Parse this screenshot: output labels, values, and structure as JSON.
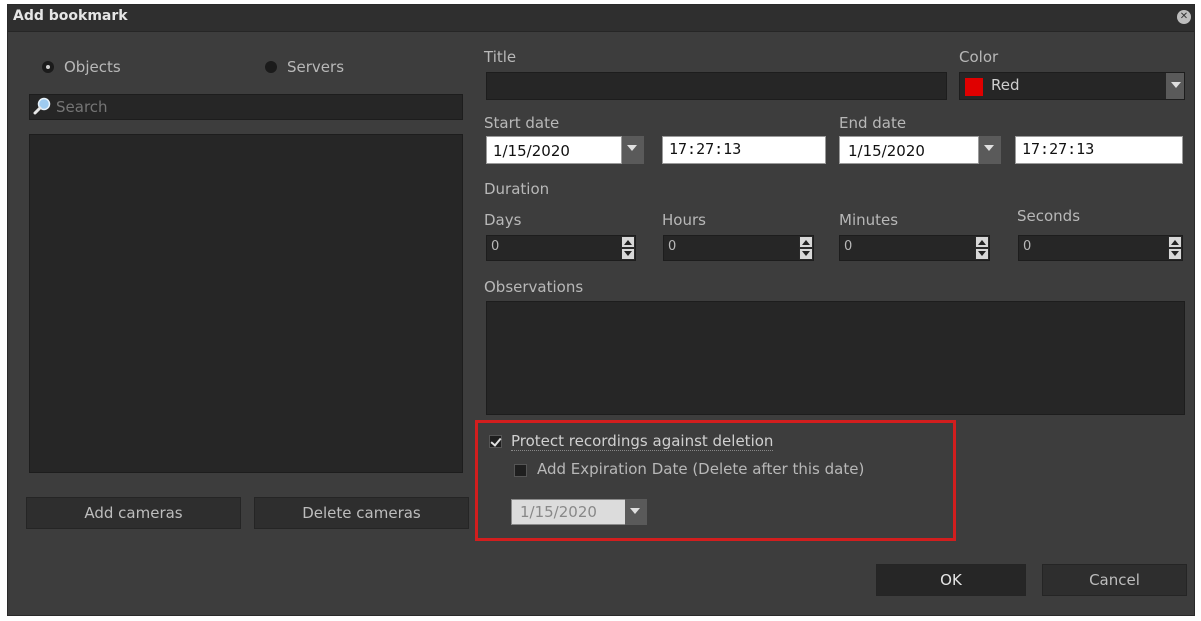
{
  "window": {
    "title": "Add bookmark"
  },
  "left": {
    "radio_objects": "Objects",
    "radio_servers": "Servers",
    "search_placeholder": "Search",
    "add_cameras": "Add cameras",
    "delete_cameras": "Delete cameras"
  },
  "form": {
    "title_label": "Title",
    "title_value": "",
    "color_label": "Color",
    "color_value": "Red",
    "color_swatch": "#e00000",
    "start_label": "Start date",
    "start_date": "1/15/2020",
    "start_time": "17:27:13",
    "end_label": "End date",
    "end_date": "1/15/2020",
    "end_time": "17:27:13",
    "duration_label": "Duration",
    "days_label": "Days",
    "days_value": "0",
    "hours_label": "Hours",
    "hours_value": "0",
    "minutes_label": "Minutes",
    "minutes_value": "0",
    "seconds_label": "Seconds",
    "seconds_value": "0",
    "observations_label": "Observations",
    "protect_label": "Protect recordings against deletion",
    "expiration_label": "Add Expiration Date (Delete after this date)",
    "expiration_date": "1/15/2020"
  },
  "footer": {
    "ok": "OK",
    "cancel": "Cancel"
  },
  "colors": {
    "highlight": "#d21e1e",
    "dialog_bg": "#3d3d3d"
  }
}
